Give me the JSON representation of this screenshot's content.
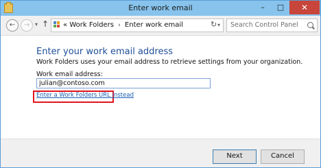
{
  "window": {
    "title": "Enter work email",
    "controls": {
      "minimize": "–",
      "maximize": "□",
      "close": "✕"
    }
  },
  "navigation": {
    "back_glyph": "←",
    "forward_glyph": "→",
    "recent_glyph": "▾",
    "up_glyph": "↑",
    "address": {
      "prefix": "«",
      "crumbs": [
        "Work Folders",
        "Enter work email"
      ],
      "separator": "›",
      "drop_glyph": "▾"
    },
    "refresh_glyph": "↻",
    "search_placeholder": "Search Control Panel"
  },
  "main": {
    "heading": "Enter your work email address",
    "description": "Work Folders uses your email address to retrieve settings from your organization.",
    "field_label": "Work email address:",
    "email_value": "julian@contoso.com",
    "alt_link": "Enter a Work Folders URL instead"
  },
  "footer": {
    "next_label": "Next",
    "cancel_label": "Cancel"
  },
  "colors": {
    "titlebar": "#87c3ec",
    "heading": "#1f4f99",
    "link": "#1a5eb4",
    "highlight": "#e0141e",
    "close_button": "#c7453a"
  }
}
